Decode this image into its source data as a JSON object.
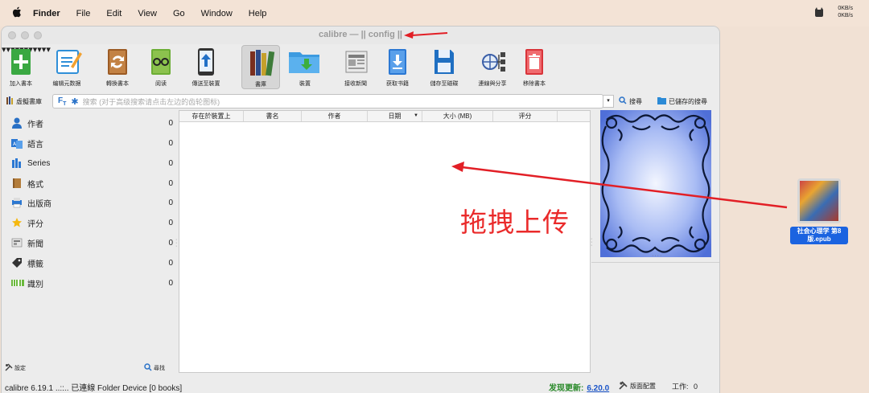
{
  "menubar": {
    "apple_icon": "apple-logo-icon",
    "app_name": "Finder",
    "items": [
      "File",
      "Edit",
      "View",
      "Go",
      "Window",
      "Help"
    ],
    "net_up": "0KB/s",
    "net_down": "0KB/s"
  },
  "window": {
    "title": "calibre — || config ||"
  },
  "toolbar": {
    "buttons": [
      {
        "label": "加入書本",
        "icon": "add-book-icon",
        "color": "#35a53b"
      },
      {
        "label": "编辑元数据",
        "icon": "edit-metadata-icon",
        "color": "#2f8fd8"
      },
      {
        "label": "轉換書本",
        "icon": "convert-icon",
        "color": "#a9652b"
      },
      {
        "label": "阅读",
        "icon": "read-icon",
        "color": "#6aa532"
      },
      {
        "label": "傳送至裝置",
        "icon": "send-device-icon",
        "color": "#2270c7"
      },
      {
        "label": "書庫",
        "icon": "library-icon",
        "color": "#7a4b25"
      },
      {
        "label": "裝置",
        "icon": "device-icon",
        "color": "#2b8ad6"
      },
      {
        "label": "接收新聞",
        "icon": "news-icon",
        "color": "#7d7d7d"
      },
      {
        "label": "获取书籍",
        "icon": "get-books-icon",
        "color": "#2b78d3"
      },
      {
        "label": "儲存至磁碟",
        "icon": "save-disk-icon",
        "color": "#1f6fc2"
      },
      {
        "label": "連線與分享",
        "icon": "connect-share-icon",
        "color": "#3b5fa8"
      },
      {
        "label": "移除書本",
        "icon": "remove-book-icon",
        "color": "#d9343a"
      }
    ]
  },
  "searchbar": {
    "virtual_library": "虛擬書庫",
    "placeholder": "搜索 (对于高级搜索请点击左边的齿轮图标)",
    "search_label": "搜尋",
    "saved_search_label": "已儲存的搜尋"
  },
  "tag_browser": {
    "items": [
      {
        "label": "作者",
        "count": "0",
        "icon": "person-icon"
      },
      {
        "label": "語言",
        "count": "0",
        "icon": "language-icon"
      },
      {
        "label": "Series",
        "count": "0",
        "icon": "series-icon"
      },
      {
        "label": "格式",
        "count": "0",
        "icon": "format-icon"
      },
      {
        "label": "出版商",
        "count": "0",
        "icon": "publisher-icon"
      },
      {
        "label": "评分",
        "count": "0",
        "icon": "star-icon"
      },
      {
        "label": "新聞",
        "count": "0",
        "icon": "news-icon"
      },
      {
        "label": "標籤",
        "count": "0",
        "icon": "tag-icon"
      },
      {
        "label": "識別",
        "count": "0",
        "icon": "barcode-icon"
      }
    ],
    "settings_label": "設定",
    "find_label": "尋找"
  },
  "book_list": {
    "columns": [
      "存在於裝置上",
      "書名",
      "作者",
      "日期",
      "大小 (MB)",
      "评分"
    ]
  },
  "statusbar": {
    "left": "calibre 6.19.1 ..::.. 已連線 Folder Device   [0 books]",
    "update_label": "发现更新:",
    "update_version": "6.20.0",
    "layout_label": "版面配置",
    "jobs_label": "工作:",
    "jobs_count": "0"
  },
  "annotation": {
    "text": "拖拽上传",
    "color": "#ea2a2a"
  },
  "desktop_file": {
    "name": "社会心理学 第8版.epub"
  }
}
